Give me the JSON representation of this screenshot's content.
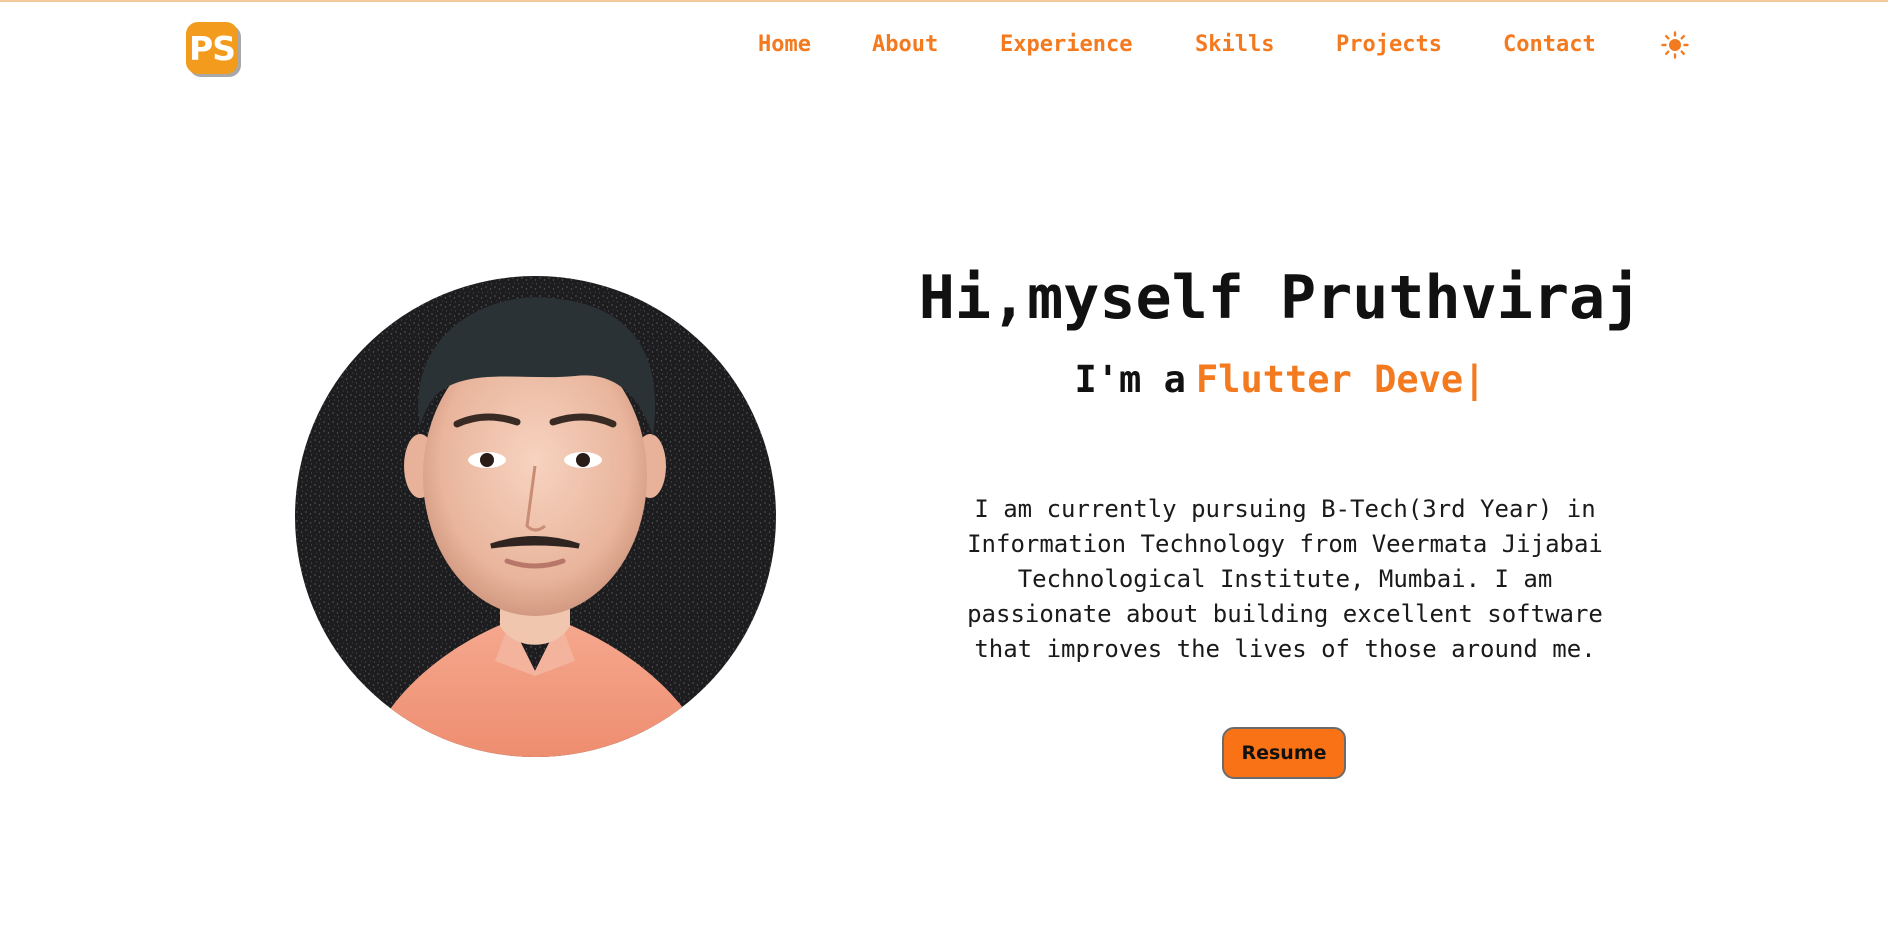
{
  "logo": {
    "text": "PS"
  },
  "nav": {
    "items": [
      {
        "label": "Home"
      },
      {
        "label": "About"
      },
      {
        "label": "Experience"
      },
      {
        "label": "Skills"
      },
      {
        "label": "Projects"
      },
      {
        "label": "Contact"
      }
    ],
    "theme_icon": "sun-icon"
  },
  "hero": {
    "title": "Hi,myself Pruthviraj",
    "role_prefix": "I'm a",
    "role_typed": "Flutter Deve",
    "cursor": "|",
    "description": "I am currently pursuing B-Tech(3rd Year) in Information Technology from Veermata Jijabai Technological Institute, Mumbai. I am passionate about building excellent software that improves the lives of those around me.",
    "resume_label": "Resume"
  },
  "colors": {
    "accent": "#f47a1f",
    "logo_bg": "#f39b1c",
    "button_bg": "#f97316",
    "text": "#111111"
  }
}
